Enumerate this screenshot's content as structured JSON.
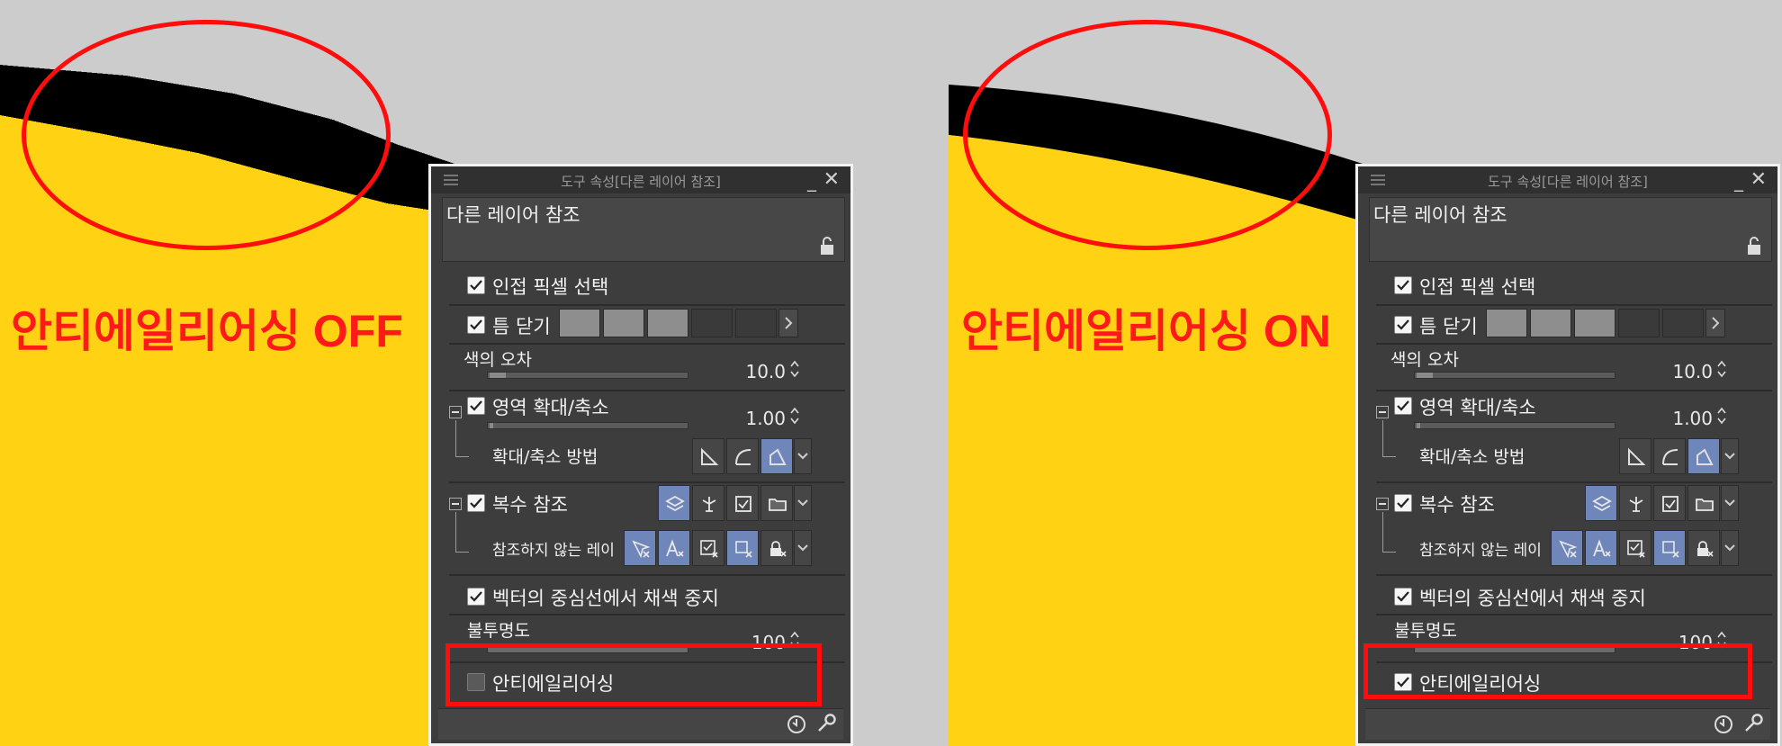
{
  "captions": {
    "left": "안티에일리어싱 OFF",
    "right": "안티에일리어싱 ON"
  },
  "colors": {
    "canvas": "#cccccc",
    "fill_yellow": "#ffd314",
    "stroke_black": "#000000",
    "highlight_red": "#ff0d0d",
    "panel_bg": "#3d3d3d",
    "active_button": "#6f86ba"
  },
  "panel": {
    "window_title": "도구 속성[다른 레이어 참조]",
    "subtool_name": "다른 레이어 참조",
    "adjacent_pixels_label": "인접 픽셀 선택",
    "close_gap_label": "틈 닫기",
    "tolerance_label": "색의 오차",
    "tolerance_value": "10.0",
    "area_scaling_label": "영역 확대/축소",
    "area_scaling_value": "1.00",
    "scaling_method_label": "확대/축소 방법",
    "multiple_ref_label": "복수 참조",
    "exclude_layers_label": "참조하지 않는 레이",
    "vector_center_label": "벡터의 중심선에서 채색 중지",
    "opacity_label": "불투명도",
    "opacity_value": "100",
    "antialias_label": "안티에일리어싱"
  },
  "left_panel": {
    "antialias_checked": false
  },
  "right_panel": {
    "antialias_checked": true
  },
  "icons": [
    "menu-grip-icon",
    "minimize-icon",
    "close-icon",
    "lock-icon",
    "checkbox-icon",
    "chevron-right-icon",
    "chevron-down-icon",
    "spinner-arrows-icon",
    "scale-method-icon",
    "layer-stack-icon",
    "paper-layer-icon",
    "reference-layer-icon",
    "folder-icon",
    "exclude-layer-icon",
    "undo-icon",
    "wrench-icon"
  ]
}
